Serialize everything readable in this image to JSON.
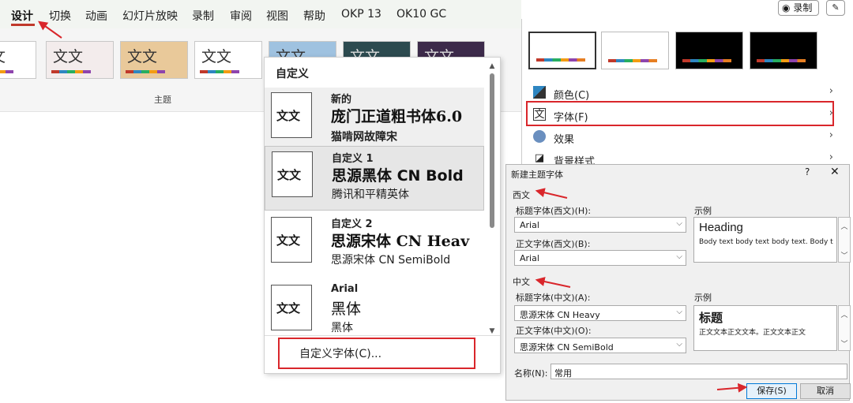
{
  "ribbon": {
    "tabs": [
      {
        "label": "设计"
      },
      {
        "label": "切换"
      },
      {
        "label": "动画"
      },
      {
        "label": "幻灯片放映"
      },
      {
        "label": "录制"
      },
      {
        "label": "审阅"
      },
      {
        "label": "视图"
      },
      {
        "label": "帮助"
      },
      {
        "label": "OKP 13"
      },
      {
        "label": "OK10 GC"
      }
    ],
    "active_tab": "设计",
    "theme_thumb_text": "文文",
    "themes_group_label": "主题"
  },
  "top_right": {
    "record_button": "录制",
    "record_icon": "record-icon",
    "pen_icon": "pen-icon"
  },
  "font_dropdown": {
    "header": "自定义",
    "preview_text": "文文",
    "items": [
      {
        "name": "新的",
        "heading": "庞门正道粗书体6.0",
        "body": "猫啃网故障宋"
      },
      {
        "name": "自定义 1",
        "heading": "思源黑体 CN Bold",
        "body": "腾讯和平精英体"
      },
      {
        "name": "自定义 2",
        "heading": "思源宋体 CN Heav",
        "body": "思源宋体 CN SemiBold"
      },
      {
        "name": "Arial",
        "heading": "黑体",
        "body": "黑体"
      }
    ],
    "custom_fonts_link": "自定义字体(C)..."
  },
  "theme_panel": {
    "menu": [
      {
        "label": "颜色(C)",
        "icon": "color-palette-icon"
      },
      {
        "label": "字体(F)",
        "icon": "font-icon"
      },
      {
        "label": "效果",
        "icon": "effects-icon"
      },
      {
        "label": "背景样式",
        "icon": "background-style-icon"
      }
    ]
  },
  "dialog": {
    "title": "新建主题字体",
    "help": "?",
    "close": "✕",
    "western_section": "西文",
    "heading_font_western_label": "标题字体(西文)(H):",
    "heading_font_western_value": "Arial",
    "body_font_western_label": "正文字体(西文)(B):",
    "body_font_western_value": "Arial",
    "sample_label": "示例",
    "western_sample_heading": "Heading",
    "western_sample_body": "Body text body text body text. Body t",
    "chinese_section": "中文",
    "heading_font_chinese_label": "标题字体(中文)(A):",
    "heading_font_chinese_value": "思源宋体 CN Heavy",
    "body_font_chinese_label": "正文字体(中文)(O):",
    "body_font_chinese_value": "思源宋体 CN SemiBold",
    "chinese_sample_heading": "标题",
    "chinese_sample_body": "正文文本正文文本。正文文本正文",
    "name_label": "名称(N):",
    "name_value": "常用",
    "save_button": "保存(S)",
    "cancel_button": "取消"
  },
  "colors": {
    "annotation_red": "#d9262b",
    "selection_blue": "#0078d7"
  }
}
